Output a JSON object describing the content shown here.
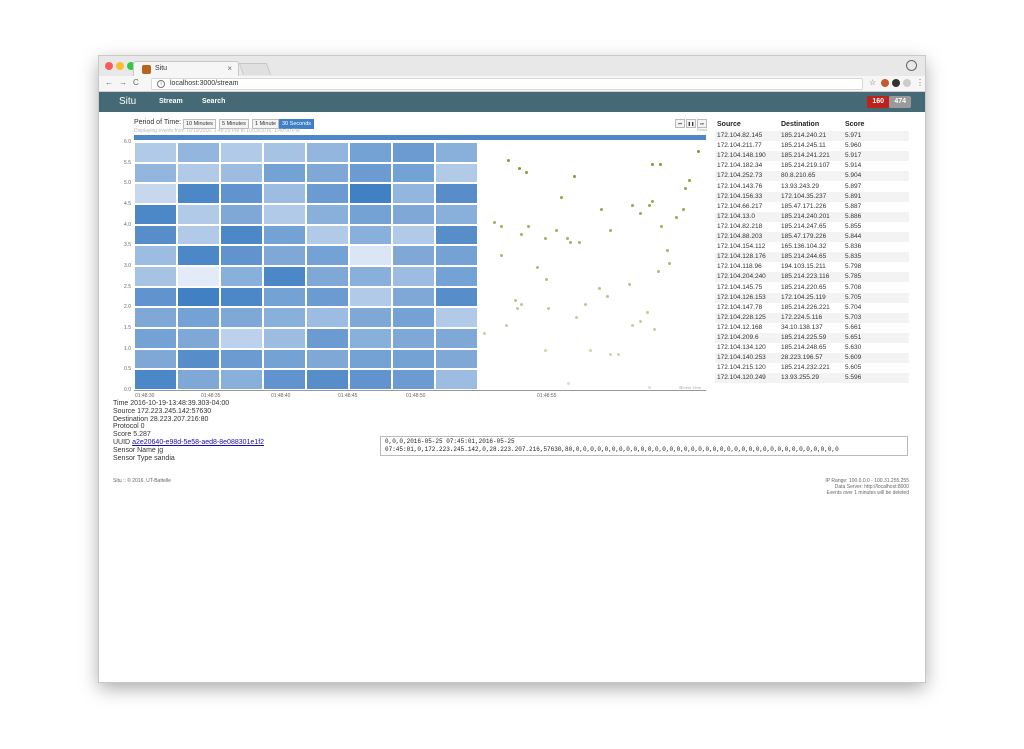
{
  "browser": {
    "tab_title": "Situ",
    "tab_close": "×",
    "url": "localhost:3000/stream"
  },
  "navbar": {
    "brand": "Situ",
    "links": [
      "Stream",
      "Search"
    ],
    "badge_red": "160",
    "badge_gray": "474",
    "colors": {
      "bar": "#466a75",
      "badge_red": "#c0211b",
      "badge_gray": "#9a9a9a"
    }
  },
  "period": {
    "label": "Period of Time:",
    "options": [
      "10 Minutes",
      "5 Minutes",
      "1 Minute",
      "30 Seconds"
    ],
    "selected": "30 Seconds",
    "subtitle": "Displaying events from 10/19/2016, 1:48:29 PM to 10/19/2016, 1:49:00 PM"
  },
  "playback": {
    "controls": [
      "⏮",
      "❚❚",
      "⏭"
    ],
    "label": "Reset"
  },
  "chart_data": {
    "type": "heatmap",
    "y_ticks": [
      "0.0",
      "0.5",
      "1.0",
      "1.5",
      "2.0",
      "2.5",
      "3.0",
      "3.5",
      "4.0",
      "4.5",
      "5.0",
      "5.5",
      "6.0"
    ],
    "x_ticks": [
      "01:48:30",
      "01:48:35",
      "01:48:40",
      "01:48:45",
      "01:48:50",
      "01:48:55"
    ],
    "ylim": [
      0,
      6
    ],
    "columns": 8,
    "rows": 12,
    "intensity": [
      [
        0.3,
        0.45,
        0.3,
        0.35,
        0.45,
        0.6,
        0.65,
        0.5
      ],
      [
        0.45,
        0.3,
        0.4,
        0.6,
        0.55,
        0.65,
        0.6,
        0.3
      ],
      [
        0.2,
        0.8,
        0.7,
        0.4,
        0.65,
        0.85,
        0.45,
        0.75
      ],
      [
        0.8,
        0.3,
        0.55,
        0.3,
        0.5,
        0.6,
        0.55,
        0.5
      ],
      [
        0.75,
        0.3,
        0.8,
        0.6,
        0.3,
        0.5,
        0.3,
        0.75
      ],
      [
        0.4,
        0.8,
        0.7,
        0.55,
        0.6,
        0.1,
        0.55,
        0.6
      ],
      [
        0.35,
        0.05,
        0.5,
        0.8,
        0.55,
        0.5,
        0.4,
        0.6
      ],
      [
        0.7,
        0.85,
        0.8,
        0.6,
        0.65,
        0.3,
        0.55,
        0.75
      ],
      [
        0.55,
        0.6,
        0.55,
        0.5,
        0.4,
        0.55,
        0.6,
        0.3
      ],
      [
        0.6,
        0.55,
        0.25,
        0.4,
        0.65,
        0.5,
        0.55,
        0.55
      ],
      [
        0.55,
        0.75,
        0.65,
        0.6,
        0.55,
        0.6,
        0.6,
        0.55
      ],
      [
        0.8,
        0.55,
        0.5,
        0.7,
        0.75,
        0.7,
        0.65,
        0.4
      ]
    ],
    "scatter_points": [
      [
        55.2,
        5.4
      ],
      [
        55.6,
        5.3
      ],
      [
        54.6,
        5.6
      ],
      [
        58.2,
        5.2
      ],
      [
        62.5,
        5.5
      ],
      [
        62.9,
        5.5
      ],
      [
        65.0,
        5.8
      ],
      [
        64.3,
        4.9
      ],
      [
        64.5,
        5.1
      ],
      [
        57.5,
        4.7
      ],
      [
        59.7,
        4.4
      ],
      [
        61.4,
        4.5
      ],
      [
        61.8,
        4.3
      ],
      [
        62.3,
        4.5
      ],
      [
        62.5,
        4.6
      ],
      [
        63.0,
        4.0
      ],
      [
        63.8,
        4.2
      ],
      [
        64.2,
        4.4
      ],
      [
        53.8,
        4.1
      ],
      [
        54.2,
        4.0
      ],
      [
        55.7,
        4.0
      ],
      [
        55.3,
        3.8
      ],
      [
        56.6,
        3.7
      ],
      [
        57.2,
        3.9
      ],
      [
        58.0,
        3.6
      ],
      [
        57.8,
        3.7
      ],
      [
        58.5,
        3.6
      ],
      [
        60.2,
        3.9
      ],
      [
        63.3,
        3.4
      ],
      [
        54.2,
        3.3
      ],
      [
        56.2,
        3.0
      ],
      [
        56.7,
        2.7
      ],
      [
        59.6,
        2.5
      ],
      [
        61.2,
        2.6
      ],
      [
        62.8,
        2.9
      ],
      [
        63.4,
        3.1
      ],
      [
        55.0,
        2.2
      ],
      [
        55.3,
        2.1
      ],
      [
        55.1,
        2.0
      ],
      [
        56.8,
        2.0
      ],
      [
        58.3,
        1.8
      ],
      [
        58.8,
        2.1
      ],
      [
        60.0,
        2.3
      ],
      [
        61.8,
        1.7
      ],
      [
        62.2,
        1.9
      ],
      [
        61.4,
        1.6
      ],
      [
        62.6,
        1.5
      ],
      [
        53.3,
        1.4
      ],
      [
        54.5,
        1.6
      ],
      [
        56.6,
        1.0
      ],
      [
        59.1,
        1.0
      ],
      [
        60.2,
        0.9
      ],
      [
        60.6,
        0.9
      ],
      [
        57.9,
        0.2
      ],
      [
        62.3,
        0.1
      ],
      [
        64.0,
        0.1
      ]
    ]
  },
  "details": {
    "time_label": "Time",
    "time": "2016-10-19-13:48:39.303-04:00",
    "source_label": "Source",
    "source": "172.223.245.142:57630",
    "destination_label": "Destination",
    "destination": "28.223.207.216:80",
    "protocol_label": "Protocol",
    "protocol": "0",
    "score_label": "Score",
    "score": "5.287",
    "uuid_label": "UUID",
    "uuid": "a2e20640-e98d-5e58-aed8-8e088301e1f2",
    "sensor_name_label": "Sensor Name",
    "sensor_name": "jg",
    "sensor_type_label": "Sensor Type",
    "sensor_type": "sandia"
  },
  "raw_event": {
    "line1": "0,0,0,2016-05-25 07:45:01,2016-05-25",
    "line2": "07:45:01,0,172.223.245.142,0,28.223.207.216,57630,80,0,0,0,0,0,0,0,0,0,0,0,0,0,0,0,0,0,0,0,0,0,0,0,0,0,0,0,0,0,0,0,0,0,0,0,0,0"
  },
  "table": {
    "headers": [
      "Source",
      "Destination",
      "Score"
    ],
    "rows": [
      [
        "172.104.82.145",
        "185.214.240.21",
        "5.971"
      ],
      [
        "172.104.211.77",
        "185.214.245.11",
        "5.960"
      ],
      [
        "172.104.148.190",
        "185.214.241.221",
        "5.917"
      ],
      [
        "172.104.182.34",
        "185.214.219.107",
        "5.914"
      ],
      [
        "172.104.252.73",
        "80.8.210.65",
        "5.904"
      ],
      [
        "172.104.143.76",
        "13.93.243.29",
        "5.897"
      ],
      [
        "172.104.156.33",
        "172.104.35.237",
        "5.891"
      ],
      [
        "172.104.66.217",
        "185.47.171.226",
        "5.887"
      ],
      [
        "172.104.13.0",
        "185.214.240.201",
        "5.886"
      ],
      [
        "172.104.82.218",
        "185.214.247.65",
        "5.855"
      ],
      [
        "172.104.88.203",
        "185.47.179.226",
        "5.844"
      ],
      [
        "172.104.154.112",
        "165.136.104.32",
        "5.836"
      ],
      [
        "172.104.128.176",
        "185.214.244.65",
        "5.835"
      ],
      [
        "172.104.118.96",
        "194.103.15.211",
        "5.798"
      ],
      [
        "172.104.204.240",
        "185.214.223.116",
        "5.785"
      ],
      [
        "172.104.145.75",
        "185.214.220.65",
        "5.708"
      ],
      [
        "172.104.126.153",
        "172.104.25.119",
        "5.705"
      ],
      [
        "172.104.147.78",
        "185.214.226.221",
        "5.704"
      ],
      [
        "172.104.228.125",
        "172.224.5.116",
        "5.703"
      ],
      [
        "172.104.12.168",
        "34.10.138.137",
        "5.661"
      ],
      [
        "172.104.209.6",
        "185.214.225.59",
        "5.651"
      ],
      [
        "172.104.134.120",
        "185.214.248.65",
        "5.630"
      ],
      [
        "172.104.140.253",
        "28.223.196.57",
        "5.609"
      ],
      [
        "172.104.215.120",
        "185.214.232.221",
        "5.605"
      ],
      [
        "172.104.120.249",
        "13.93.255.29",
        "5.596"
      ]
    ]
  },
  "footer": {
    "copyright": "Situ :: © 2016, UT-Battelle",
    "ip_range": "IP Range: 100.0.0.0 - 100.31.255.255",
    "data_server": "Data Server: http://localhost:8000",
    "retention": "Events over 1 minutes will be deleted"
  }
}
